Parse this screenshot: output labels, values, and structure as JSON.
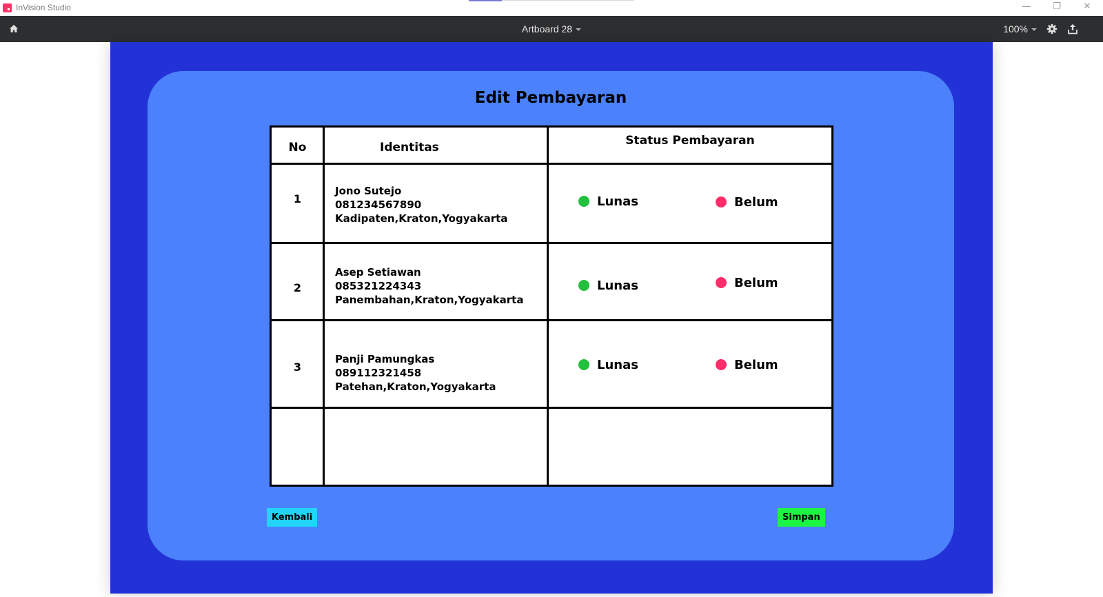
{
  "window": {
    "app_name": "InVision Studio",
    "minimize_glyph": "—",
    "maximize_glyph": "❐",
    "close_glyph": "✕"
  },
  "toolbar": {
    "artboard_title": "Artboard 28",
    "zoom": "100%",
    "icons": [
      "home-icon",
      "gear-icon",
      "share-icon"
    ]
  },
  "page": {
    "title": "Edit Pembayaran",
    "table": {
      "headers": {
        "no": "No",
        "identity": "Identitas",
        "status": "Status Pembayaran"
      },
      "rows": [
        {
          "no": "1",
          "name": "Jono Sutejo",
          "phone": "081234567890",
          "address": "Kadipaten,Kraton,Yogyakarta",
          "option_paid": "Lunas",
          "option_unpaid": "Belum"
        },
        {
          "no": "2",
          "name": "Asep Setiawan",
          "phone": "085321224343",
          "address": "Panembahan,Kraton,Yogyakarta",
          "option_paid": "Lunas",
          "option_unpaid": "Belum"
        },
        {
          "no": "3",
          "name": "Panji Pamungkas",
          "phone": "089112321458",
          "address": "Patehan,Kraton,Yogyakarta",
          "option_paid": "Lunas",
          "option_unpaid": "Belum"
        }
      ]
    },
    "buttons": {
      "back": "Kembali",
      "save": "Simpan"
    }
  },
  "colors": {
    "artboard_bg": "#2332d6",
    "card_bg": "#4b82fb",
    "paid_dot": "#22c03c",
    "unpaid_dot": "#ff2d6a",
    "back_button": "#23d4f7",
    "save_button": "#1df543"
  }
}
